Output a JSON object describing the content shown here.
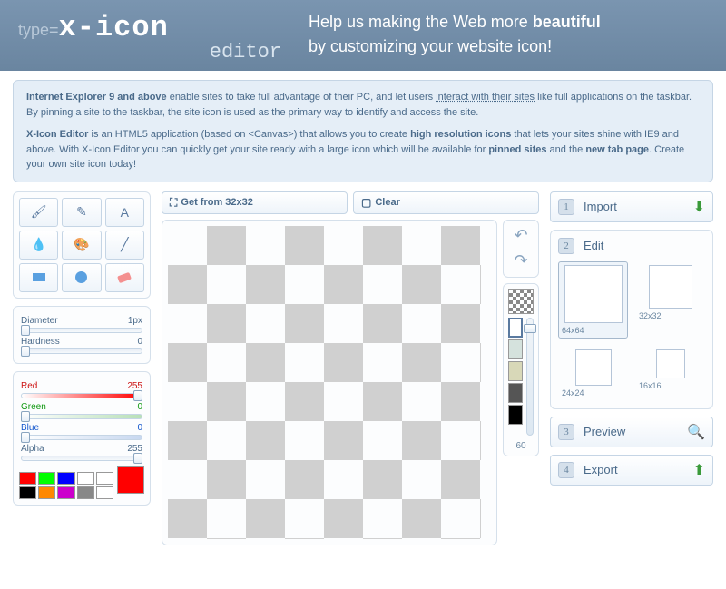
{
  "header": {
    "logo_type": "type=",
    "logo_brand": "x-icon",
    "logo_editor": "editor",
    "tagline_1": "Help us making the Web more ",
    "tagline_bold": "beautiful",
    "tagline_2": "by customizing your website icon!"
  },
  "info": {
    "p1_b1": "Internet Explorer 9 and above",
    "p1_t1": " enable sites to take full advantage of their PC, and let users ",
    "p1_link": "interact with their sites",
    "p1_t2": " like full applications on the taskbar. By pinning a site to the taskbar, the site icon is used as the primary way to identify and access the site.",
    "p2_b1": "X-Icon Editor",
    "p2_t1": " is an HTML5 application (based on <Canvas>) that allows you to create ",
    "p2_b2": "high resolution icons",
    "p2_t2": " that lets your sites shine with IE9 and above. With X-Icon Editor you can quickly get your site ready with a large icon which will be available for ",
    "p2_b3": "pinned sites",
    "p2_t3": " and the ",
    "p2_b4": "new tab page",
    "p2_t4": ". Create your own site icon today!"
  },
  "actions": {
    "get_from": "Get from 32x32",
    "clear": "Clear"
  },
  "sliders": {
    "diameter": {
      "label": "Diameter",
      "value": "1px",
      "pos": 0
    },
    "hardness": {
      "label": "Hardness",
      "value": "0",
      "pos": 0
    },
    "red": {
      "label": "Red",
      "value": "255",
      "pos": 100
    },
    "green": {
      "label": "Green",
      "value": "0",
      "pos": 0
    },
    "blue": {
      "label": "Blue",
      "value": "0",
      "pos": 0
    },
    "alpha": {
      "label": "Alpha",
      "value": "255",
      "pos": 100
    }
  },
  "swatches": [
    "#ff0000",
    "#00ff00",
    "#0000ff",
    "#ffffff",
    "#ffffff",
    "#000000",
    "#ff8800",
    "#cc00cc",
    "#888888",
    "#ffffff"
  ],
  "current_color": "#ff0000",
  "side": {
    "zoom_value": "60",
    "palette": [
      "#ffffff",
      "#d5e2dd",
      "#d8d8b8",
      "#555555",
      "#000000"
    ]
  },
  "steps": {
    "import": {
      "num": "1",
      "label": "Import"
    },
    "edit": {
      "num": "2",
      "label": "Edit"
    },
    "preview": {
      "num": "3",
      "label": "Preview"
    },
    "export": {
      "num": "4",
      "label": "Export"
    }
  },
  "sizes": {
    "s64": "64x64",
    "s32": "32x32",
    "s24": "24x24",
    "s16": "16x16"
  }
}
